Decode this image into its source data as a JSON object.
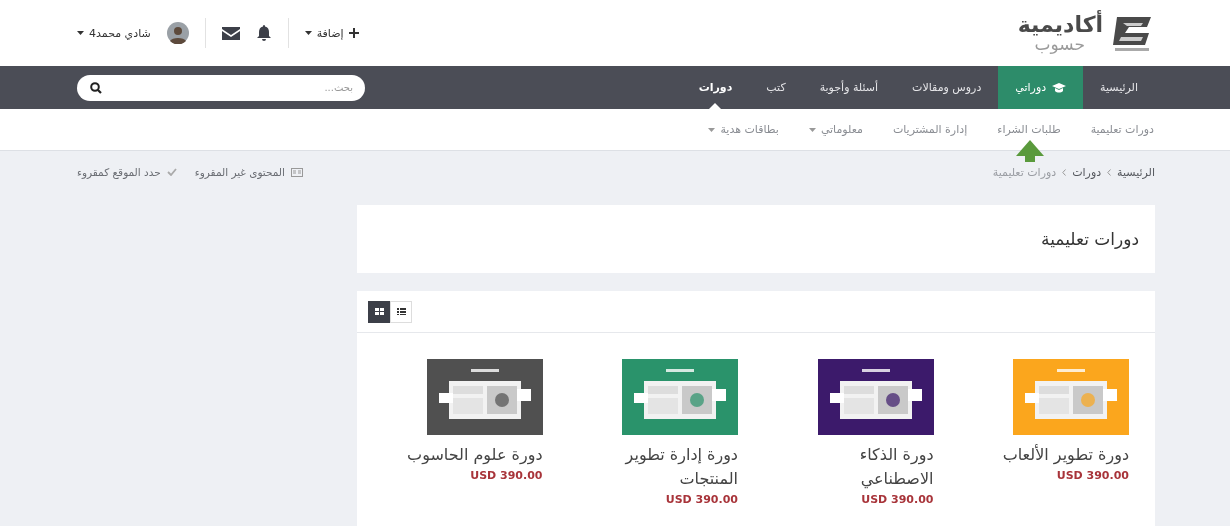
{
  "header": {
    "logo": {
      "title": "أكاديمية",
      "subtitle": "حسوب"
    },
    "add_menu": {
      "label": "إضافة"
    },
    "user": {
      "name": "شادي محمد4"
    }
  },
  "nav": {
    "items": [
      {
        "label": "الرئيسية",
        "selected": false,
        "current": false,
        "icon": false
      },
      {
        "label": "دوراتي",
        "selected": true,
        "current": false,
        "icon": true
      },
      {
        "label": "دروس ومقالات",
        "selected": false,
        "current": false,
        "icon": false
      },
      {
        "label": "أسئلة وأجوبة",
        "selected": false,
        "current": false,
        "icon": false
      },
      {
        "label": "كتب",
        "selected": false,
        "current": false,
        "icon": false
      },
      {
        "label": "دورات",
        "selected": false,
        "current": true,
        "icon": false
      }
    ],
    "search": {
      "placeholder": "بحث..."
    }
  },
  "subnav": {
    "items": [
      {
        "label": "دورات تعليمية",
        "dropdown": false
      },
      {
        "label": "طلبات الشراء",
        "dropdown": false
      },
      {
        "label": "إدارة المشتريات",
        "dropdown": false
      },
      {
        "label": "معلوماتي",
        "dropdown": true
      },
      {
        "label": "بطاقات هدية",
        "dropdown": true
      }
    ]
  },
  "breadcrumb": [
    "الرئيسية",
    "دورات",
    "دورات تعليمية"
  ],
  "tools": [
    {
      "label": "المحتوى غير المقروء",
      "kind": "unread"
    },
    {
      "label": "حدد الموقع كمقروء",
      "kind": "mark-read"
    }
  ],
  "page_title": "دورات تعليمية",
  "view_toggle": [
    {
      "kind": "grid",
      "selected": true
    },
    {
      "kind": "list",
      "selected": false
    }
  ],
  "courses": [
    {
      "title": "دورة تطوير الألعاب",
      "price": "USD 390.00",
      "color": "#fba61d"
    },
    {
      "title": "دورة الذكاء الاصطناعي",
      "price": "USD 390.00",
      "color": "#3c1a6b"
    },
    {
      "title": "دورة إدارة تطوير المنتجات",
      "price": "USD 390.00",
      "color": "#2a936b"
    },
    {
      "title": "دورة علوم الحاسوب",
      "price": "USD 390.00",
      "color": "#505050"
    }
  ]
}
